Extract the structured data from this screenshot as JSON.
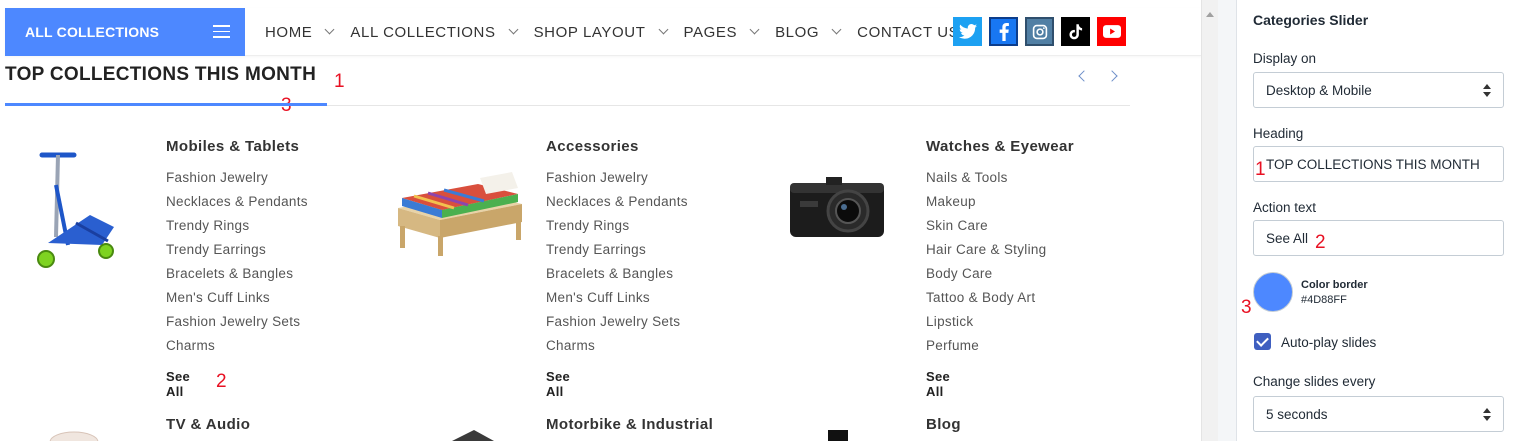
{
  "nav": {
    "all_collections": "ALL COLLECTIONS",
    "menu": [
      "HOME",
      "ALL COLLECTIONS",
      "SHOP LAYOUT",
      "PAGES",
      "BLOG",
      "CONTACT US"
    ],
    "social": [
      {
        "name": "twitter-icon",
        "color": "#1da1f2",
        "glyph": "t"
      },
      {
        "name": "facebook-icon",
        "color": "#1877f2",
        "glyph": "f"
      },
      {
        "name": "instagram-icon",
        "color": "#517fa4",
        "glyph": "◎"
      },
      {
        "name": "tiktok-icon",
        "color": "#000000",
        "glyph": "♪"
      },
      {
        "name": "youtube-icon",
        "color": "#ff0000",
        "glyph": "▶"
      }
    ]
  },
  "section": {
    "title": "TOP COLLECTIONS THIS MONTH",
    "accent_color": "#4D88FF"
  },
  "annotations": {
    "a1": "1",
    "a2": "2",
    "a3": "3"
  },
  "collections": [
    {
      "name": "Mobiles & Tablets",
      "image": "scooter",
      "items": [
        "Fashion Jewelry",
        "Necklaces & Pendants",
        "Trendy Rings",
        "Trendy Earrings",
        "Bracelets & Bangles",
        "Men's Cuff Links",
        "Fashion Jewelry Sets",
        "Charms"
      ],
      "see_all": "See All"
    },
    {
      "name": "Accessories",
      "image": "bed",
      "items": [
        "Fashion Jewelry",
        "Necklaces & Pendants",
        "Trendy Rings",
        "Trendy Earrings",
        "Bracelets & Bangles",
        "Men's Cuff Links",
        "Fashion Jewelry Sets",
        "Charms"
      ],
      "see_all": "See All"
    },
    {
      "name": "Watches & Eyewear",
      "image": "dashcam",
      "items": [
        "Nails & Tools",
        "Makeup",
        "Skin Care",
        "Hair Care & Styling",
        "Body Care",
        "Tattoo & Body Art",
        "Lipstick",
        "Perfume"
      ],
      "see_all": "See All"
    }
  ],
  "collections_row2": [
    "TV & Audio",
    "Motorbike & Industrial",
    "Blog"
  ],
  "panel": {
    "title": "Categories Slider",
    "display_on_label": "Display on",
    "display_on_value": "Desktop & Mobile",
    "heading_label": "Heading",
    "heading_value": "TOP COLLECTIONS THIS MONTH",
    "action_label": "Action text",
    "action_value": "See All",
    "color_border_label": "Color border",
    "color_border_value": "#4D88FF",
    "autoplay_label": "Auto-play slides",
    "autoplay_checked": true,
    "change_every_label": "Change slides every",
    "change_every_value": "5 seconds"
  }
}
